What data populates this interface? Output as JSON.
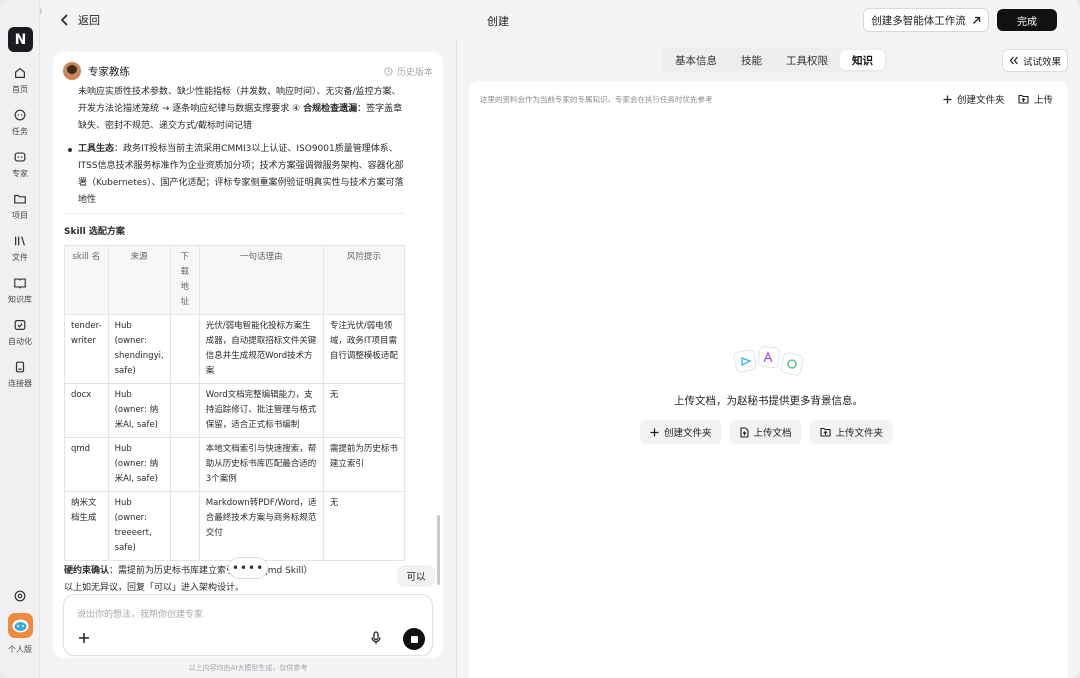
{
  "topbar": {
    "back_label": "返回",
    "title": "创建",
    "workflow_label": "创建多智能体工作流",
    "done_label": "完成"
  },
  "rail": {
    "items": [
      {
        "label": "首页",
        "icon": "home-icon"
      },
      {
        "label": "任务",
        "icon": "chat-icon"
      },
      {
        "label": "专家",
        "icon": "bot-icon"
      },
      {
        "label": "项目",
        "icon": "folder-icon"
      },
      {
        "label": "文件",
        "icon": "library-icon"
      },
      {
        "label": "知识库",
        "icon": "book-icon"
      },
      {
        "label": "自动化",
        "icon": "check-calendar-icon"
      },
      {
        "label": "连接器",
        "icon": "device-icon"
      }
    ],
    "settings_icon": "settings-icon",
    "profile_label": "个人版"
  },
  "chat": {
    "name": "专家教练",
    "history_label": "历史版本",
    "para1": "未响应实质性技术参数、缺少性能指标（并发数、响应时间）、无灾备/监控方案、开发方法论描述笼统 → 逐条响应纪律与数据支撑要求 ④ ",
    "para1_bold": "合规检查遗漏",
    "para1_tail": "：签字盖章缺失、密封不规范、递交方式/截标时间记错",
    "bullet_bold": "工具生态",
    "bullet_text": "：政务IT投标当前主流采用CMMI3以上认证、ISO9001质量管理体系、ITSS信息技术服务标准作为企业资质加分项；技术方案强调微服务架构、容器化部署（Kubernetes）、国产化适配；评标专家侧重案例验证明真实性与技术方案可落地性",
    "skill_title": "Skill 选配方案",
    "table_headers": [
      "skill 名",
      "来源",
      "下载地址",
      "一句话理由",
      "风险提示"
    ],
    "table_rows": [
      [
        "tender-writer",
        "Hub (owner: shendingyi, safe)",
        "",
        "光伏/弱电智能化投标方案生成器，自动提取招标文件关键信息并生成规范Word技术方案",
        "专注光伏/弱电领域，政务IT项目需自行调整模板适配"
      ],
      [
        "docx",
        "Hub (owner: 纳米AI, safe)",
        "",
        "Word文档完整编辑能力，支持追踪修订、批注管理与格式保留，适合正式标书编制",
        "无"
      ],
      [
        "qmd",
        "Hub (owner: 纳米AI, safe)",
        "",
        "本地文档索引与快速搜索，帮助从历史标书库匹配最合适的3个案例",
        "需提前为历史标书建立索引"
      ],
      [
        "纳米文档生成",
        "Hub (owner: treeeert, safe)",
        "",
        "Markdown转PDF/Word，适合最终技术方案与商务标规范交付",
        "无"
      ]
    ],
    "confirm_bold": "硬约束确认",
    "confirm_text": "：需提前为历史标书库建立索引（使用qmd Skill）",
    "closing": "以上如无异议，回复「可以」进入架构设计。",
    "dots": "••••",
    "user_reply": "可以",
    "composer_placeholder": "说出你的想法，我帮你创建专家",
    "disclaimer": "以上内容均由AI大模型生成，仅供参考"
  },
  "right": {
    "tabs": [
      {
        "label": "基本信息",
        "active": false
      },
      {
        "label": "技能",
        "active": false
      },
      {
        "label": "工具权限",
        "active": false
      },
      {
        "label": "知识",
        "active": true
      }
    ],
    "try_label": "试试效果",
    "hint": "这里的资料会作为当前专家的专属知识，专家会在执行任务时优先参考",
    "new_folder_label": "创建文件夹",
    "upload_label": "上传",
    "empty_text": "上传文档，为赵秘书提供更多背景信息。",
    "actions": [
      {
        "label": "创建文件夹",
        "icon": "plus-icon"
      },
      {
        "label": "上传文档",
        "icon": "file-upload-icon"
      },
      {
        "label": "上传文件夹",
        "icon": "folder-upload-icon"
      }
    ]
  }
}
